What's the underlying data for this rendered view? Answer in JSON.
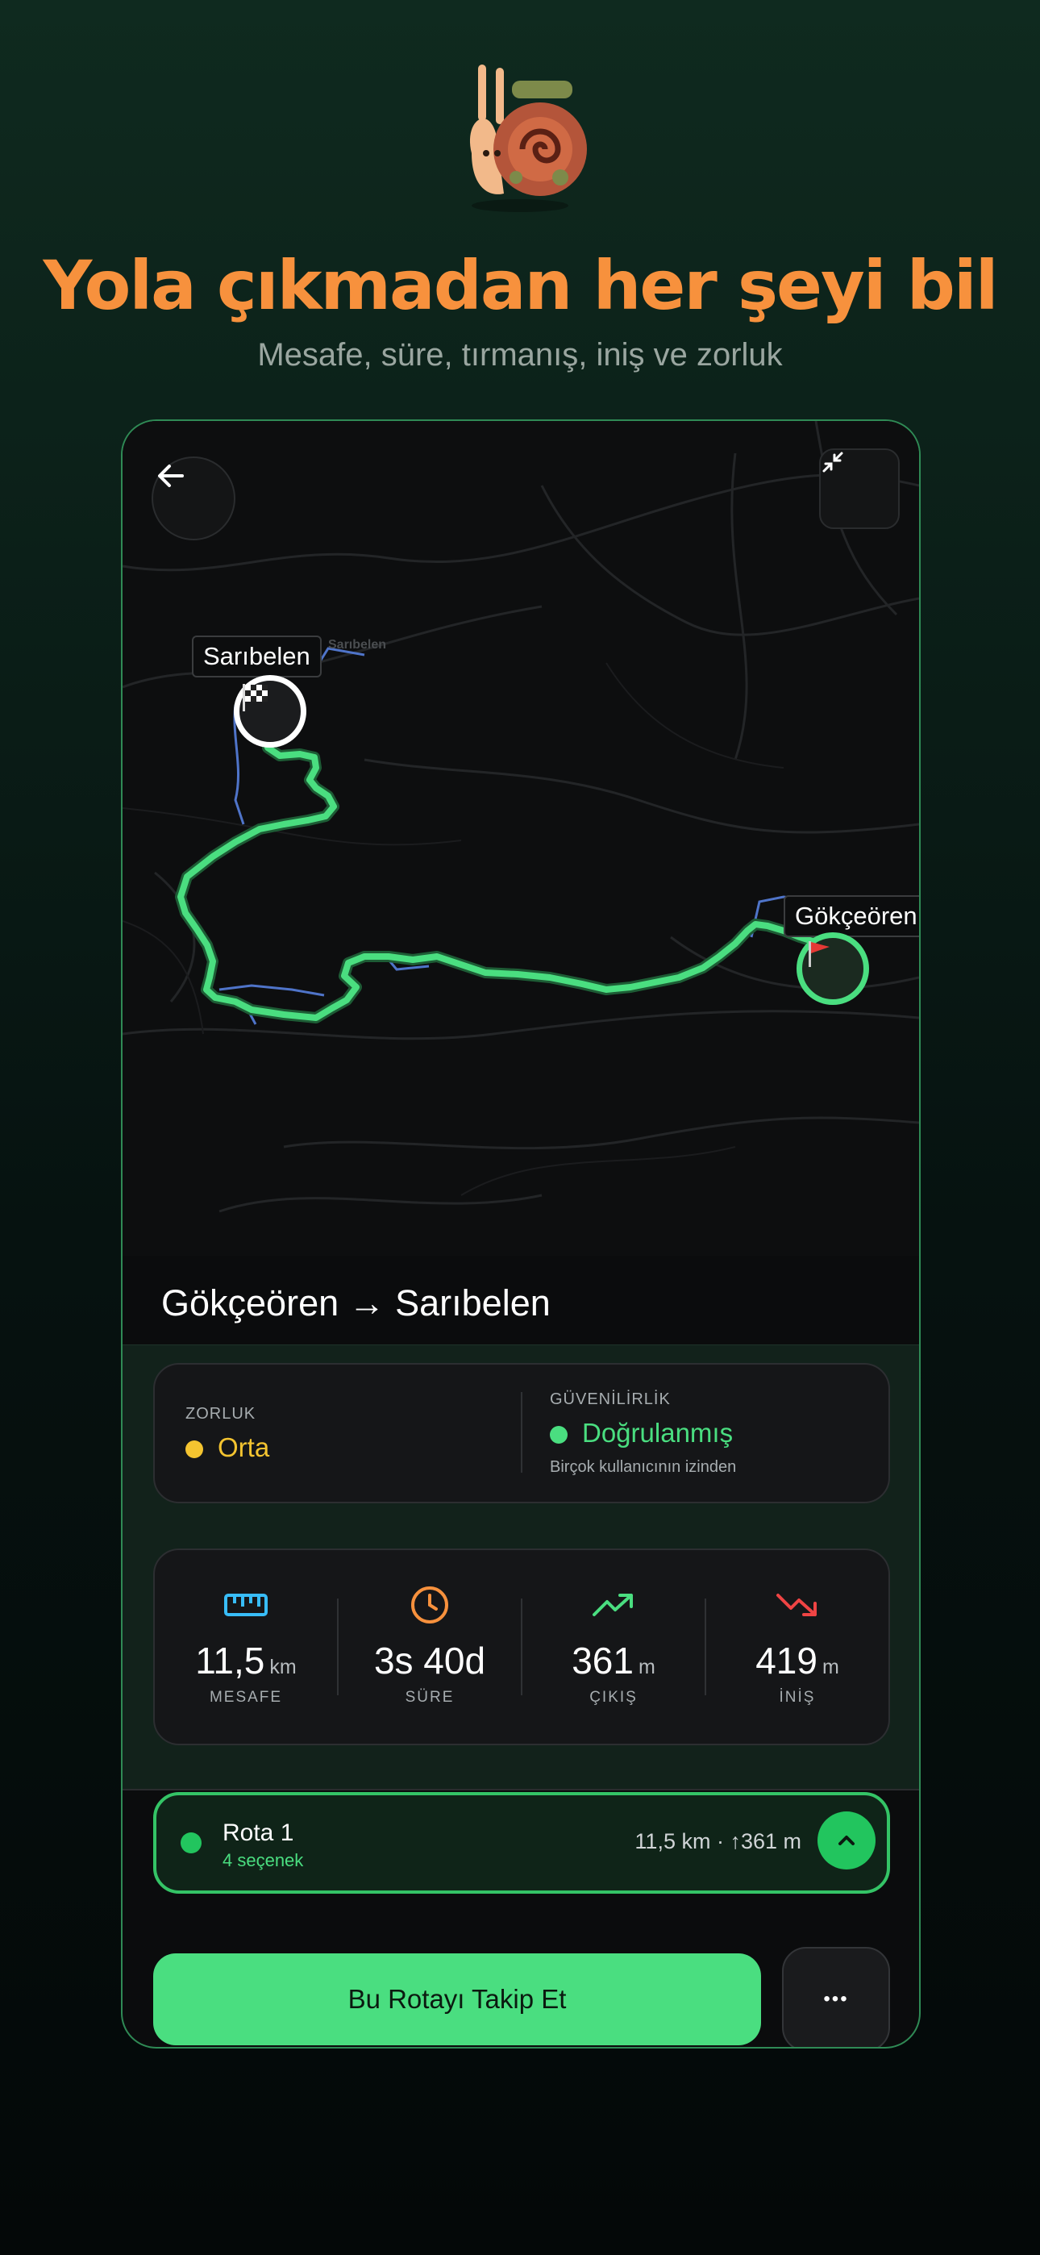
{
  "promo": {
    "headline": "Yola çıkmadan her şeyi bil",
    "subheadline": "Mesafe, süre, tırmanış, iniş ve zorluk"
  },
  "map": {
    "start_label": "Sarıbelen",
    "end_label": "Gökçeören",
    "faint_start_label": "Sarıbelen",
    "route_color": "#4ade80",
    "alt_route_color": "#4f74c9"
  },
  "route": {
    "title": "Gökçeören → Sarıbelen"
  },
  "difficulty": {
    "label": "ZORLUK",
    "value": "Orta",
    "color": "#f4c430"
  },
  "reliability": {
    "label": "GÜVENİLİRLİK",
    "value": "Doğrulanmış",
    "note": "Birçok kullanıcının izinden",
    "color": "#4ade80"
  },
  "stats": [
    {
      "icon": "ruler-icon",
      "value": "11,5",
      "unit": "km",
      "caption": "MESAFE",
      "color": "#38bdf8"
    },
    {
      "icon": "clock-icon",
      "value": "3s 40d",
      "unit": "",
      "caption": "SÜRE",
      "color": "#f7913d"
    },
    {
      "icon": "trending-up-icon",
      "value": "361",
      "unit": "m",
      "caption": "ÇIKIŞ",
      "color": "#4ade80"
    },
    {
      "icon": "trending-down-icon",
      "value": "419",
      "unit": "m",
      "caption": "İNİŞ",
      "color": "#ef4444"
    }
  ],
  "route_option": {
    "name": "Rota 1",
    "options": "4 seçenek",
    "summary": "11,5 km · ↑361 m"
  },
  "actions": {
    "follow": "Bu Rotayı Takip Et",
    "more": "•••"
  }
}
